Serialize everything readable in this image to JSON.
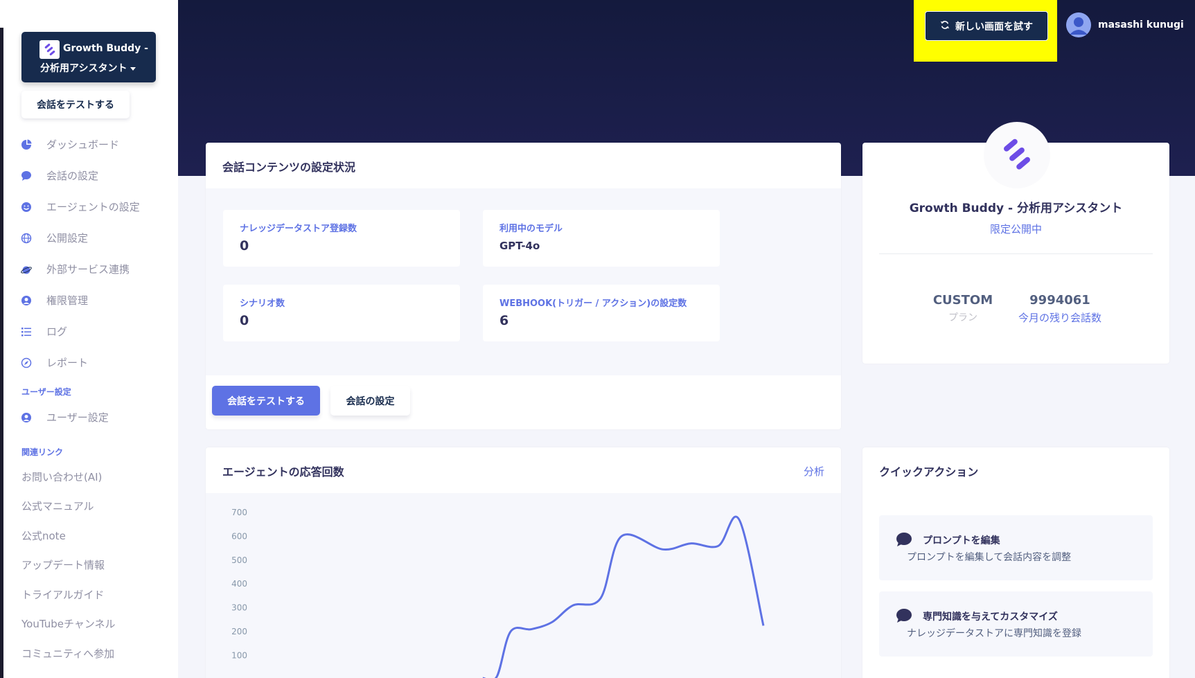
{
  "sidebar": {
    "brand_line1": "Growth Buddy -",
    "brand_line2": "分析用アシスタント",
    "test_button": "会話をテストする",
    "nav_items": [
      {
        "label": "ダッシュボード",
        "icon": "pie-chart-icon"
      },
      {
        "label": "会話の設定",
        "icon": "chat-bubble-icon"
      },
      {
        "label": "エージェントの設定",
        "icon": "smiley-icon"
      },
      {
        "label": "公開設定",
        "icon": "globe-icon"
      },
      {
        "label": "外部サービス連携",
        "icon": "planet-icon"
      },
      {
        "label": "権限管理",
        "icon": "user-circle-icon"
      },
      {
        "label": "ログ",
        "icon": "list-icon"
      },
      {
        "label": "レポート",
        "icon": "compass-icon"
      }
    ],
    "user_heading": "ユーザー設定",
    "user_item": "ユーザー設定",
    "links_heading": "関連リンク",
    "links": [
      "お問い合わせ(AI)",
      "公式マニュアル",
      "公式note",
      "アップデート情報",
      "トライアルガイド",
      "YouTubeチャンネル",
      "コミュニティへ参加"
    ]
  },
  "header": {
    "try_button": "新しい画面を試す",
    "user_name": "masashi kunugi"
  },
  "content_card": {
    "title": "会話コンテンツの設定状況",
    "stats": [
      {
        "label": "ナレッジデータストア登録数",
        "value": "0"
      },
      {
        "label": "利用中のモデル",
        "value": "GPT-4o"
      },
      {
        "label": "シナリオ数",
        "value": "0"
      },
      {
        "label": "WEBHOOK(トリガー / アクション)の設定数",
        "value": "6"
      }
    ],
    "primary_button": "会話をテストする",
    "secondary_button": "会話の設定"
  },
  "profile": {
    "name": "Growth Buddy - 分析用アシスタント",
    "status": "限定公開中",
    "plan_value": "CUSTOM",
    "plan_label": "プラン",
    "remaining_value": "9994061",
    "remaining_label": "今月の残り会話数"
  },
  "chart_card": {
    "title": "エージェントの応答回数",
    "link": "分析"
  },
  "chart_data": {
    "type": "line",
    "title": "",
    "xlabel": "",
    "ylabel": "",
    "yticks": [
      "700",
      "600",
      "500",
      "400",
      "300",
      "200",
      "100"
    ],
    "ylim": [
      0,
      700
    ],
    "series": [
      {
        "values": [
          5,
          10,
          200,
          210,
          240,
          310,
          340,
          600,
          545,
          570,
          560,
          670,
          225
        ]
      }
    ],
    "color": "#5e72e4"
  },
  "quick_actions": {
    "title": "クイックアクション",
    "items": [
      {
        "title": "プロンプトを編集",
        "desc": "プロンプトを編集して会話内容を調整"
      },
      {
        "title": "専門知識を与えてカスタマイズ",
        "desc": "ナレッジデータストアに専門知識を登録"
      }
    ]
  },
  "colors": {
    "accent": "#5e72e4",
    "header_bg": "#141a3d",
    "highlight": "#ffff00",
    "brand_dark": "#172b4d"
  }
}
